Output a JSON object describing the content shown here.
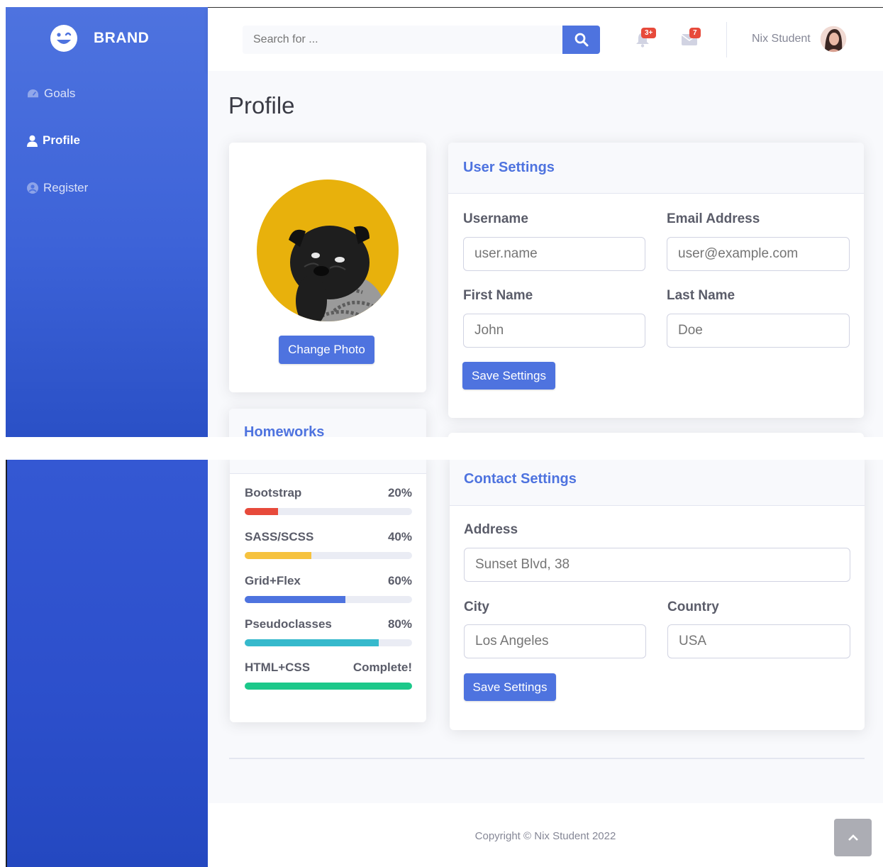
{
  "brand": {
    "name": "BRAND",
    "logo_icon": "laugh-wink-icon"
  },
  "sidebar": {
    "items": [
      {
        "label": "Goals",
        "icon": "tachometer-icon",
        "active": false
      },
      {
        "label": "Profile",
        "icon": "user-icon",
        "active": true
      },
      {
        "label": "Register",
        "icon": "user-circle-icon",
        "active": false
      }
    ]
  },
  "topbar": {
    "search_placeholder": "Search for ...",
    "alerts_badge": "3+",
    "messages_badge": "7",
    "user_name": "Nix Student"
  },
  "page": {
    "title": "Profile"
  },
  "photo_card": {
    "change_photo_label": "Change Photo"
  },
  "homeworks": {
    "title": "Homeworks",
    "items": [
      {
        "name": "Bootstrap",
        "value_label": "20%",
        "progress": 20,
        "color": "#e74a3b"
      },
      {
        "name": "SASS/SCSS",
        "value_label": "40%",
        "progress": 40,
        "color": "#f6c23e"
      },
      {
        "name": "Grid+Flex",
        "value_label": "60%",
        "progress": 60,
        "color": "#4e73df"
      },
      {
        "name": "Pseudoclasses",
        "value_label": "80%",
        "progress": 80,
        "color": "#36b9cc"
      },
      {
        "name": "HTML+CSS",
        "value_label": "Complete!",
        "progress": 100,
        "color": "#1cc88a"
      }
    ]
  },
  "user_settings": {
    "title": "User Settings",
    "username_label": "Username",
    "username_placeholder": "user.name",
    "email_label": "Email Address",
    "email_placeholder": "user@example.com",
    "first_name_label": "First Name",
    "first_name_placeholder": "John",
    "last_name_label": "Last Name",
    "last_name_placeholder": "Doe",
    "save_label": "Save Settings"
  },
  "contact_settings": {
    "title": "Contact Settings",
    "address_label": "Address",
    "address_placeholder": "Sunset Blvd, 38",
    "city_label": "City",
    "city_placeholder": "Los Angeles",
    "country_label": "Country",
    "country_placeholder": "USA",
    "save_label": "Save Settings"
  },
  "footer": {
    "copyright": "Copyright © Nix Student 2022"
  },
  "colors": {
    "primary": "#4e73df",
    "danger": "#e74a3b",
    "warning": "#f6c23e",
    "info": "#36b9cc",
    "success": "#1cc88a",
    "avatar_bg": "#e8b10c"
  }
}
